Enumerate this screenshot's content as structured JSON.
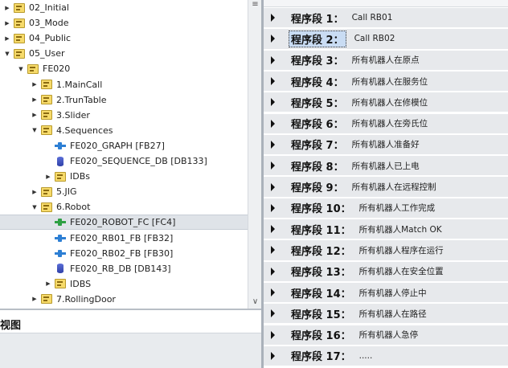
{
  "tree": {
    "items": [
      {
        "label": "02_Initial",
        "expander": "collapsed",
        "icon": "folder-icon"
      },
      {
        "label": "03_Mode",
        "expander": "collapsed",
        "icon": "folder-icon"
      },
      {
        "label": "04_Public",
        "expander": "collapsed",
        "icon": "folder-icon"
      },
      {
        "label": "05_User",
        "expander": "expanded",
        "icon": "folder-icon"
      },
      {
        "label": "FE020",
        "expander": "expanded",
        "icon": "folder-icon"
      },
      {
        "label": "1.MainCall",
        "expander": "collapsed",
        "icon": "folder-icon"
      },
      {
        "label": "2.TrunTable",
        "expander": "collapsed",
        "icon": "folder-icon"
      },
      {
        "label": "3.Slider",
        "expander": "collapsed",
        "icon": "folder-icon"
      },
      {
        "label": "4.Sequences",
        "expander": "expanded",
        "icon": "folder-icon"
      },
      {
        "label": "FE020_GRAPH [FB27]",
        "expander": "none",
        "icon": "function-block-icon"
      },
      {
        "label": "FE020_SEQUENCE_DB [DB133]",
        "expander": "none",
        "icon": "data-block-icon"
      },
      {
        "label": "IDBs",
        "expander": "collapsed",
        "icon": "folder-icon"
      },
      {
        "label": "5.JIG",
        "expander": "collapsed",
        "icon": "folder-icon"
      },
      {
        "label": "6.Robot",
        "expander": "expanded",
        "icon": "folder-icon"
      },
      {
        "label": "FE020_ROBOT_FC [FC4]",
        "expander": "none",
        "icon": "function-icon",
        "selected": true
      },
      {
        "label": "FE020_RB01_FB [FB32]",
        "expander": "none",
        "icon": "function-block-icon"
      },
      {
        "label": "FE020_RB02_FB [FB30]",
        "expander": "none",
        "icon": "function-block-icon"
      },
      {
        "label": "FE020_RB_DB [DB143]",
        "expander": "none",
        "icon": "data-block-icon"
      },
      {
        "label": "IDBS",
        "expander": "collapsed",
        "icon": "folder-icon"
      },
      {
        "label": "7.RollingDoor",
        "expander": "collapsed",
        "icon": "folder-icon"
      }
    ]
  },
  "bottom_panel": {
    "title": "视图"
  },
  "networks": {
    "items": [
      {
        "label": "程序段 1：",
        "title": "Call  RB01"
      },
      {
        "label": "程序段 2：",
        "title": "Call  RB02",
        "selected": true
      },
      {
        "label": "程序段 3：",
        "title": "所有机器人在原点"
      },
      {
        "label": "程序段 4：",
        "title": "所有机器人在服务位"
      },
      {
        "label": "程序段 5：",
        "title": "所有机器人在修模位"
      },
      {
        "label": "程序段 6：",
        "title": "所有机器人在旁氏位"
      },
      {
        "label": "程序段 7：",
        "title": "所有机器人准备好"
      },
      {
        "label": "程序段 8：",
        "title": "所有机器人已上电"
      },
      {
        "label": "程序段 9：",
        "title": "所有机器人在远程控制"
      },
      {
        "label": "程序段 10：",
        "title": "所有机器人工作完成"
      },
      {
        "label": "程序段 11：",
        "title": "所有机器人Match  OK"
      },
      {
        "label": "程序段 12：",
        "title": "所有机器人程序在运行"
      },
      {
        "label": "程序段 13：",
        "title": "所有机器人在安全位置"
      },
      {
        "label": "程序段 14：",
        "title": "所有机器人停止中"
      },
      {
        "label": "程序段 15：",
        "title": "所有机器人在路径"
      },
      {
        "label": "程序段 16：",
        "title": "所有机器人急停"
      },
      {
        "label": "程序段 17：",
        "title": "....."
      }
    ]
  },
  "icons": {
    "expand": "▼",
    "collapse": "▶",
    "scroll_up": "≡",
    "scroll_down": "∨"
  }
}
